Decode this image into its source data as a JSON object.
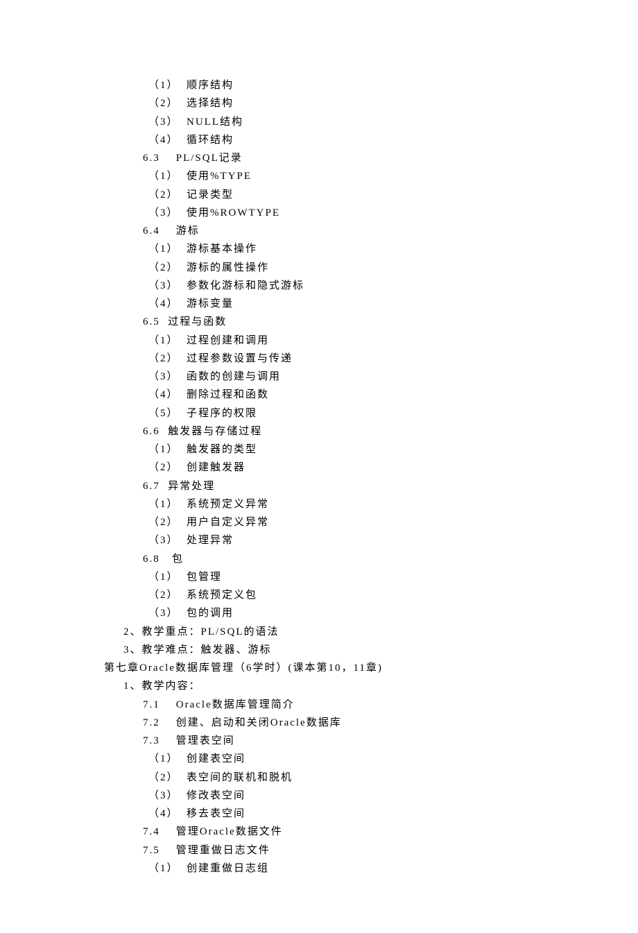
{
  "lines": [
    {
      "indent": 3,
      "text": "（1）  顺序结构"
    },
    {
      "indent": 3,
      "text": "（2）  选择结构"
    },
    {
      "indent": 3,
      "text": "（3）  NULL结构"
    },
    {
      "indent": 3,
      "text": "（4）  循环结构"
    },
    {
      "indent": 2,
      "text": "6.3    PL/SQL记录"
    },
    {
      "indent": 3,
      "text": "（1）  使用%TYPE"
    },
    {
      "indent": 3,
      "text": "（2）  记录类型"
    },
    {
      "indent": 3,
      "text": "（3）  使用%ROWTYPE"
    },
    {
      "indent": 2,
      "text": "6.4    游标"
    },
    {
      "indent": 3,
      "text": "（1）  游标基本操作"
    },
    {
      "indent": 3,
      "text": "（2）  游标的属性操作"
    },
    {
      "indent": 3,
      "text": "（3）  参数化游标和隐式游标"
    },
    {
      "indent": 3,
      "text": "（4）  游标变量"
    },
    {
      "indent": 2,
      "text": "6.5  过程与函数"
    },
    {
      "indent": 3,
      "text": "（1）  过程创建和调用"
    },
    {
      "indent": 3,
      "text": "（2）  过程参数设置与传递"
    },
    {
      "indent": 3,
      "text": "（3）  函数的创建与调用"
    },
    {
      "indent": 3,
      "text": "（4）  删除过程和函数"
    },
    {
      "indent": 3,
      "text": "（5）  子程序的权限"
    },
    {
      "indent": 2,
      "text": "6.6  触发器与存储过程"
    },
    {
      "indent": 3,
      "text": "（1）  触发器的类型"
    },
    {
      "indent": 3,
      "text": "（2）  创建触发器"
    },
    {
      "indent": 2,
      "text": "6.7  异常处理"
    },
    {
      "indent": 3,
      "text": "（1）  系统预定义异常"
    },
    {
      "indent": 3,
      "text": "（2）  用户自定义异常"
    },
    {
      "indent": 3,
      "text": "（3）  处理异常"
    },
    {
      "indent": 2,
      "text": "6.8   包"
    },
    {
      "indent": 3,
      "text": "（1）  包管理"
    },
    {
      "indent": 3,
      "text": "（2）  系统预定义包"
    },
    {
      "indent": 3,
      "text": "（3）  包的调用"
    },
    {
      "indent": 1,
      "text": "2、教学重点：PL/SQL的语法"
    },
    {
      "indent": 1,
      "text": "3、教学难点：触发器、游标"
    },
    {
      "indent": 0,
      "text": "第七章Oracle数据库管理（6学时）(课本第10，11章)"
    },
    {
      "indent": 1,
      "text": "1、教学内容："
    },
    {
      "indent": 2,
      "text": "7.1    Oracle数据库管理简介"
    },
    {
      "indent": 2,
      "text": "7.2    创建、启动和关闭Oracle数据库"
    },
    {
      "indent": 2,
      "text": "7.3    管理表空间"
    },
    {
      "indent": 3,
      "text": "（1）  创建表空间"
    },
    {
      "indent": 3,
      "text": "（2）  表空间的联机和脱机"
    },
    {
      "indent": 3,
      "text": "（3）  修改表空间"
    },
    {
      "indent": 3,
      "text": "（4）  移去表空间"
    },
    {
      "indent": 2,
      "text": "7.4    管理Oracle数据文件"
    },
    {
      "indent": 2,
      "text": "7.5    管理重做日志文件"
    },
    {
      "indent": 3,
      "text": "（1）  创建重做日志组"
    }
  ]
}
